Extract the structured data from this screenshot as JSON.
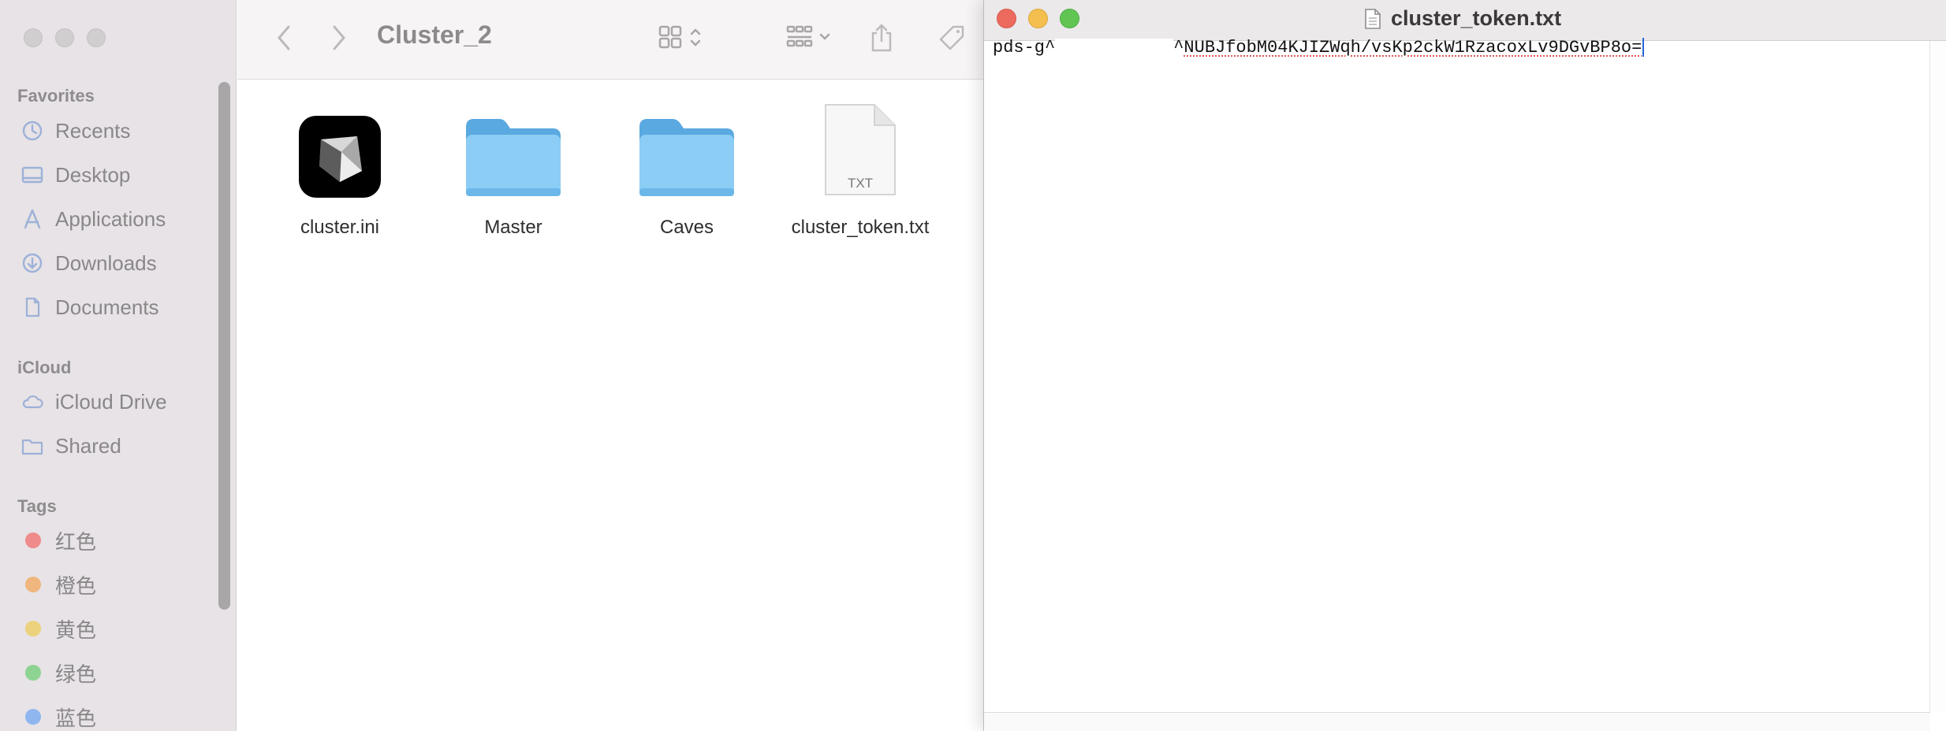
{
  "finder": {
    "title": "Cluster_2",
    "sidebar": {
      "favorites_heading": "Favorites",
      "favorites": [
        {
          "label": "Recents",
          "icon": "clock-icon"
        },
        {
          "label": "Desktop",
          "icon": "desktop-icon"
        },
        {
          "label": "Applications",
          "icon": "applications-icon"
        },
        {
          "label": "Downloads",
          "icon": "download-icon"
        },
        {
          "label": "Documents",
          "icon": "document-icon"
        }
      ],
      "icloud_heading": "iCloud",
      "icloud": [
        {
          "label": "iCloud Drive",
          "icon": "cloud-icon"
        },
        {
          "label": "Shared",
          "icon": "shared-folder-icon"
        }
      ],
      "tags_heading": "Tags",
      "tags": [
        {
          "label": "红色",
          "color": "#ef8b8b"
        },
        {
          "label": "橙色",
          "color": "#efb67e"
        },
        {
          "label": "黄色",
          "color": "#ecd27c"
        },
        {
          "label": "绿色",
          "color": "#8dd392"
        },
        {
          "label": "蓝色",
          "color": "#8fb6ef"
        }
      ]
    },
    "files": [
      {
        "name": "cluster.ini",
        "icon": "app-icon"
      },
      {
        "name": "Master",
        "icon": "folder-icon"
      },
      {
        "name": "Caves",
        "icon": "folder-icon"
      },
      {
        "name": "cluster_token.txt",
        "icon": "txt-file-icon",
        "badge": "TXT"
      }
    ]
  },
  "textedit": {
    "title": "cluster_token.txt",
    "text_prefix": "pds-g^",
    "text_mid": "^",
    "text_suffix": "NUBJfobM04KJIZWqh/vsKp2ckW1RzacoxLv9DGvBP8o=",
    "lights": {
      "close": "#ed6a5e",
      "minimize": "#f5bf4f",
      "zoom": "#61c554"
    }
  }
}
